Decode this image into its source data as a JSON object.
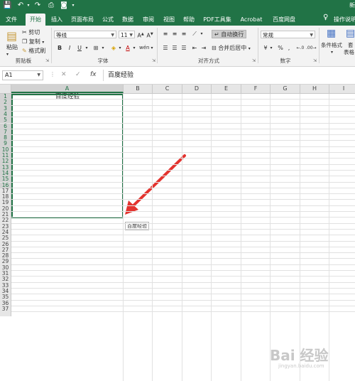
{
  "app": {
    "title_fragment": "新",
    "accent": "#217346"
  },
  "quick_access": {
    "icons": [
      "save-icon",
      "undo-icon",
      "redo-icon",
      "print-preview-icon",
      "camera-icon",
      "customize-icon"
    ]
  },
  "tabs": [
    {
      "label": "文件"
    },
    {
      "label": "开始",
      "active": true
    },
    {
      "label": "插入"
    },
    {
      "label": "页面布局"
    },
    {
      "label": "公式"
    },
    {
      "label": "数据"
    },
    {
      "label": "审阅"
    },
    {
      "label": "视图"
    },
    {
      "label": "帮助"
    },
    {
      "label": "PDF工具集"
    },
    {
      "label": "Acrobat"
    },
    {
      "label": "百度网盘"
    }
  ],
  "tell_me": "操作说明搜索",
  "ribbon": {
    "clipboard": {
      "paste_label": "粘贴",
      "cut_label": "剪切",
      "copy_label": "复制",
      "format_painter_label": "格式刷",
      "group_label": "剪贴板"
    },
    "font": {
      "font_name": "等线",
      "font_size": "11",
      "bold": "B",
      "italic": "I",
      "underline": "U",
      "group_label": "字体"
    },
    "alignment": {
      "wrap_text_label": "自动换行",
      "merge_center_label": "合并后居中",
      "group_label": "对齐方式"
    },
    "number": {
      "format": "常规",
      "percent": "%",
      "comma": ",",
      "group_label": "数字"
    },
    "styles": {
      "conditional_label": "条件格式",
      "table_label": "套",
      "table_label2": "表格"
    }
  },
  "formula_bar": {
    "name_box": "A1",
    "fx": "fx",
    "content": "百度经验"
  },
  "grid": {
    "columns": [
      "A",
      "B",
      "C",
      "D",
      "E",
      "F",
      "G",
      "H",
      "I"
    ],
    "selected_column": "A",
    "rows": [
      "1",
      "2",
      "3",
      "4",
      "5",
      "6",
      "7",
      "8",
      "9",
      "10",
      "11",
      "12",
      "13",
      "14",
      "15",
      "16",
      "17",
      "18",
      "19",
      "20",
      "21",
      "22",
      "23",
      "24",
      "25",
      "26",
      "27",
      "28",
      "29",
      "30",
      "31",
      "32",
      "33",
      "34",
      "35",
      "36",
      "37"
    ],
    "a1_value": "百度经验",
    "selected_rows_through": 16,
    "tooltip": "百度经验"
  },
  "watermark": {
    "text": "Bai 经验",
    "url": "jingyan.baidu.com"
  }
}
